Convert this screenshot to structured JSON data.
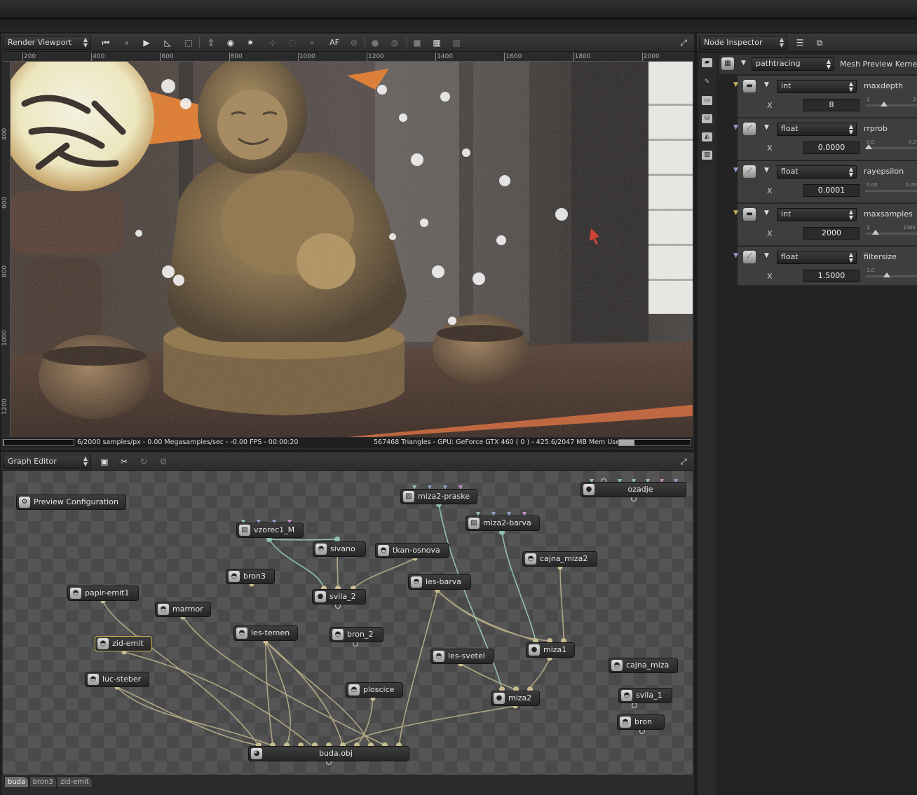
{
  "viewport": {
    "title": "Render Viewport",
    "ruler_x": [
      "200",
      "400",
      "600",
      "800",
      "1000",
      "1200",
      "1400",
      "1600",
      "1800",
      "2000"
    ],
    "ruler_y": [
      "400",
      "600",
      "800",
      "1000",
      "1200"
    ],
    "toolbar_af": "AF",
    "status_left": "6/2000 samples/px - 0.00 Megasamples/sec - -0.00 FPS - 00:00:20",
    "status_right": "567468 Triangles - GPU: GeForce GTX 460 ( 0 ) - 425.6/2047 MB Mem Used",
    "progress": 0.003
  },
  "graph": {
    "title": "Graph Editor",
    "nodes": [
      {
        "id": "preview",
        "label": "Preview Configuration"
      },
      {
        "id": "papir",
        "label": "papir-emit1"
      },
      {
        "id": "zid",
        "label": "zid-emit"
      },
      {
        "id": "luc",
        "label": "luc-steber"
      },
      {
        "id": "marmor",
        "label": "marmor"
      },
      {
        "id": "bron3",
        "label": "bron3"
      },
      {
        "id": "vzorec",
        "label": "vzorec1_M"
      },
      {
        "id": "sivano",
        "label": "sivano"
      },
      {
        "id": "tkan",
        "label": "tkan-osnova"
      },
      {
        "id": "svila2",
        "label": "svila_2"
      },
      {
        "id": "lestemen",
        "label": "les-temen"
      },
      {
        "id": "bron2",
        "label": "bron_2"
      },
      {
        "id": "ploscice",
        "label": "ploscice"
      },
      {
        "id": "buda",
        "label": "buda.obj"
      },
      {
        "id": "miza2praske",
        "label": "miza2-praske"
      },
      {
        "id": "miza2barva",
        "label": "miza2-barva"
      },
      {
        "id": "lesbarva",
        "label": "les-barva"
      },
      {
        "id": "lessvetel",
        "label": "les-svetel"
      },
      {
        "id": "miza2",
        "label": "miza2"
      },
      {
        "id": "cajnamiza2",
        "label": "cajna_miza2"
      },
      {
        "id": "miza1",
        "label": "miza1"
      },
      {
        "id": "ozadje",
        "label": "ozadje"
      },
      {
        "id": "cajnamiza",
        "label": "cajna_miza"
      },
      {
        "id": "svila1",
        "label": "svila_1"
      },
      {
        "id": "bron",
        "label": "bron"
      }
    ],
    "tabs": [
      "buda",
      "bron3",
      "zid-emit"
    ]
  },
  "inspector": {
    "title": "Node Inspector",
    "kernel_type": "pathtracing",
    "kernel_name": "Mesh Preview Kernel",
    "axis_label": "X",
    "params": [
      {
        "type": "int",
        "name": "maxdepth",
        "value": "8",
        "smin": "1",
        "smax": "3",
        "level": 0.35
      },
      {
        "type": "float",
        "name": "rrprob",
        "value": "0.0000",
        "smin": "0.0",
        "smax": "0.2",
        "level": 0.0
      },
      {
        "type": "float",
        "name": "rayepsilon",
        "value": "0.0001",
        "smin": "0.00",
        "smax": "0.00",
        "level": 0.0
      },
      {
        "type": "int",
        "name": "maxsamples",
        "value": "2000",
        "smin": "1",
        "smax": "1066",
        "level": 0.15
      },
      {
        "type": "float",
        "name": "filtersize",
        "value": "1.5000",
        "smin": "1.0",
        "smax": "",
        "level": 0.4
      }
    ]
  },
  "colors": {
    "accent": "#c7b55a",
    "link": "#b5ab86",
    "tex_link": "#8fc2ad"
  }
}
